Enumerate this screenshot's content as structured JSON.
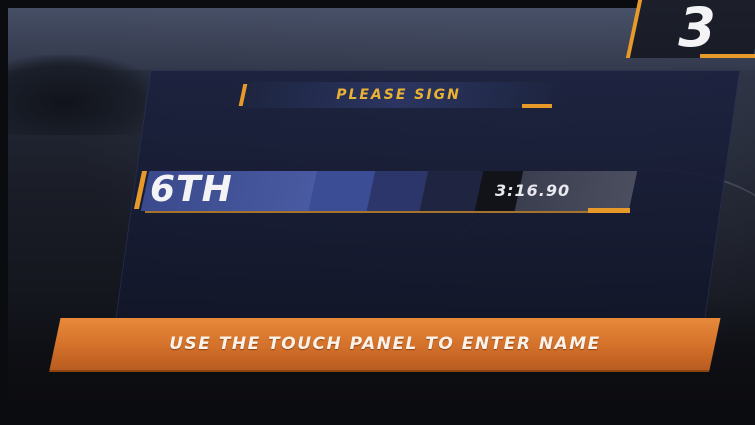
{
  "hud": {
    "lap_number": "3"
  },
  "dialog": {
    "header": "PLEASE SIGN",
    "result": {
      "rank": "6TH",
      "time": "3:16.90"
    },
    "instruction": "USE THE TOUCH PANEL TO ENTER NAME"
  },
  "colors": {
    "accent": "#e79a2a",
    "header_text": "#eab234",
    "panel": "#1c223e",
    "rank_bar": "#4a5aa2",
    "banner": "#d3702a"
  }
}
